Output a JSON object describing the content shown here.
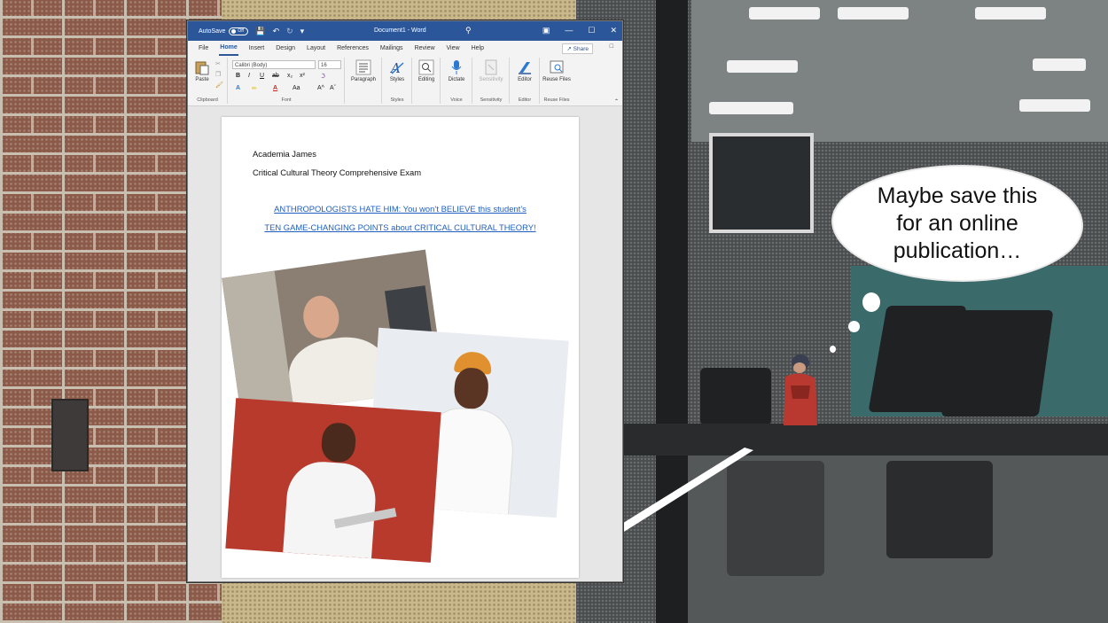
{
  "word": {
    "autosave_label": "AutoSave",
    "autosave_state": "Off",
    "document_title": "Document1 - Word",
    "menu": [
      "File",
      "Home",
      "Insert",
      "Design",
      "Layout",
      "References",
      "Mailings",
      "Review",
      "View",
      "Help"
    ],
    "active_tab": "Home",
    "share_label": "Share",
    "ribbon": {
      "paste_label": "Paste",
      "clipboard_group": "Clipboard",
      "font_name": "Calibri (Body)",
      "font_size": "16",
      "font_group": "Font",
      "bold": "B",
      "italic": "I",
      "underline": "U",
      "strike": "ab",
      "subscript": "x₂",
      "superscript": "x²",
      "grow": "A^",
      "shrink": "Aˇ",
      "change_case": "Aa",
      "paragraph_label": "Paragraph",
      "styles_label": "Styles",
      "styles_group": "Styles",
      "editing_label": "Editing",
      "dictate_label": "Dictate",
      "voice_group": "Voice",
      "sensitivity_label": "Sensitivity",
      "sensitivity_group": "Sensitivity",
      "editor_label": "Editor",
      "editor_group": "Editor",
      "reuse_label": "Reuse Files",
      "reuse_group": "Reuse Files"
    },
    "document": {
      "line1": "Academia James",
      "line2": "Critical Cultural Theory Comprehensive Exam",
      "link1": "ANTHROPOLOGISTS HATE HIM: You won’t BELIEVE this student’s",
      "link2": "TEN GAME-CHANGING POINTS about CRITICAL CULTURAL THEORY!"
    }
  },
  "scene": {
    "thought_bubble": "Maybe save this for an online publication…"
  },
  "colors": {
    "word_blue": "#2b579a",
    "link_blue": "#1f5fbf",
    "brick": "#8b5a48"
  }
}
